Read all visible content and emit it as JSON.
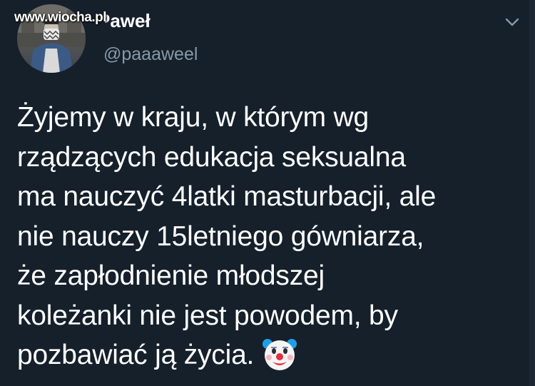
{
  "watermark": "www.wiocha.pl",
  "author": {
    "name": "Paweł",
    "handle": "@paaaweel"
  },
  "tweet": {
    "lines": [
      "Żyjemy w kraju, w którym wg",
      "rządzących edukacja seksualna",
      "ma nauczyć 4latki masturbacji, ale",
      "nie nauczy 15letniego gówniarza,",
      "że zapłodnienie młodszej",
      "koleżanki nie jest powodem, by",
      "pozbawiać ją życia."
    ],
    "emoji": "clown-face"
  },
  "icons": {
    "menu": "chevron-down-icon"
  },
  "colors": {
    "background": "#15202b",
    "primary_text": "#ffffff",
    "secondary_text": "#8899a6"
  }
}
